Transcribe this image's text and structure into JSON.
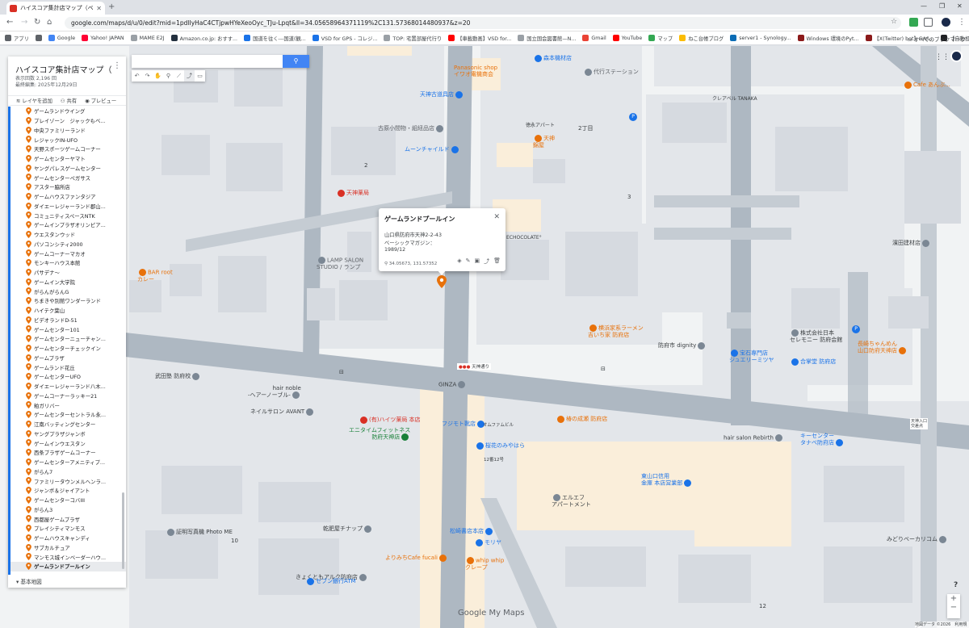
{
  "browser": {
    "tab_title": "ハイスコア集計店マップ（ベーシック...",
    "url": "google.com/maps/d/u/0/edit?mid=1pdlIyHaC4CTjpwHYeXeoOyc_TJu-Lpqt&ll=34.05658964371119%2C131.57368014480937&z=20",
    "bookmarks": [
      "アプリ",
      "Google",
      "Yahoo! JAPAN",
      "MAME E2J",
      "Amazon.co.jp: おすす...",
      "国道を往く---国道(観...",
      "VSD for GPS - コレジ...",
      "TOP: 宅置部屋代行り",
      "【車載動画】VSD for...",
      "国立国会図書館—N...",
      "Gmail",
      "YouTube",
      "マップ",
      "ねこ台帳ブログ",
      "server1 - Synology...",
      "Windows 環境のPyt...",
      "【X(Twitter) bot】GAS...",
      "【自動投稿】GASスプ..."
    ],
    "all_bookmarks": "すべてのブックマーク"
  },
  "panel": {
    "title": "ハイスコア集計店マップ（ベーシ...",
    "views": "表示回数 2,196 回",
    "edited": "最終編集: 2025年12月29日",
    "add_layer": "レイヤを追加",
    "share": "共有",
    "preview": "プレビュー",
    "items": [
      "ゲームランドウイング",
      "プレイゾーン　ジャックもベ...",
      "中央ファミリーランド",
      "レジャックIN-UFO",
      "天野スポーツゲームコーナー",
      "ゲームセンターヤマト",
      "ヤングパレスゲームセンター",
      "ゲームセンターペガサス",
      "アスター脇所店",
      "ゲームハウスファンタジア",
      "ダイエーレジャーランド郡山...",
      "コミュニティスペースNTK",
      "ゲームインプラザオリンピア...",
      "ウエスタンウッド",
      "パソコンシティ2000",
      "ゲームコーナーマカオ",
      "モンキーハウス本館",
      "パサデナ～",
      "ゲームイン大学院",
      "がらんがらんG",
      "ちまきや別館ワンダーランド",
      "ハイテク葉山",
      "ビデオランドD-51",
      "ゲームセンター101",
      "ゲームセンターニューチャン...",
      "ゲームセンターチェックイン",
      "ゲームプラザ",
      "ゲームランド花丘",
      "ゲームセンターUFO",
      "ダイエーレジャーランド八木...",
      "ゲームコーナーラッキー21",
      "粕ガリバー",
      "ゲームセンターセントラル永...",
      "江南バッティングセンター",
      "ヤングプラザジャンボ",
      "ゲームインウエスタン",
      "西条プラザゲームコーナー",
      "ゲームセンターアメニティプ...",
      "がらん7",
      "ファミリータウンメルヘンラ...",
      "ジャンボ＆ジャイアント",
      "ゲームセンターコバIII",
      "がらん3",
      "西都屋ゲームプラザ",
      "プレイシティマンモス",
      "ゲームハウスキャンディ",
      "サブカルチュア",
      "マンモス城インベーダーハウ...",
      "ゲームランドプールイン"
    ],
    "base_map": "基本地図"
  },
  "search": {
    "placeholder": ""
  },
  "popup": {
    "title": "ゲームランドプールイン",
    "address": "山口県防府市天神2-2-43",
    "line2": "ベーシックマガジン：",
    "line3": "1989/12",
    "coords": "34.05673, 131.57352"
  },
  "map_labels": {
    "panasonic": "Panasonic shop\nイワオ電機商会",
    "morimoto": "森本機材店",
    "daiko": "代行ステーション",
    "tenjin_koppu": "天神古道具店",
    "cafe_anbu": "Cafe あんぶ...",
    "kure": "クレアベル TANAKA",
    "kohara": "古原小間物・組紐品店",
    "toku_apart": "徳永アパート",
    "tenjin": "天神\n錦屋",
    "nichome": "2丁目",
    "moon": "ムーンチャイルド",
    "n2": "2",
    "n3": "3",
    "tenjin_lab": "天神薬局",
    "chocolate": "ECHOCOLATE°",
    "hamada": "濱田建材店",
    "lamp": "LAMP SALON\nSTUDIO / ランプ",
    "bar_root": "BAR root\nカレー",
    "ramen": "横浜家系ラーメン\n吉いち家 防府店",
    "dignity": "防府市 dignity",
    "seremony": "株式会社日本\nセレモニー 防府会館",
    "nagasaki": "長崎ちゃんめん\n山口防府天神店",
    "hoseki": "宝石専門店\nジュエリーミツヤ",
    "gokaku": "合掌堂 防府店",
    "takeda": "武田塾 防府校",
    "tenjin_st": "天神通り",
    "hair_noble": "hair noble\n-ヘアーノーブル-",
    "ginza": "GINZA",
    "avant": "ネイルサロン AVANT",
    "haitsu": "(有)ハイツ薬局 本店",
    "fujimoto": "フジモト靴店",
    "tsubaki": "椿の成瀬 防府店",
    "n_famu": "オムファムビル",
    "anytime": "エニタイムフィットネス\n防府天神店",
    "hanamiya": "桜花のみやはら",
    "n12": "12番12号",
    "rebirth": "hair salon Rebirth",
    "kisenter": "キーセンター\nタナベ防府店",
    "yamaguchi_bank": "東山口信用\n金庫 本店営業部",
    "elfa": "エルエフ\nアパートメント",
    "shomei": "証明写真機 Photo ME",
    "n10": "10",
    "kanshiya": "乾肥屋チナップ",
    "matsuzaki": "松崎書店本店",
    "moriya": "モリヤ",
    "whip": "whip whip\nクレープ",
    "midori": "みどりベーカリコム",
    "kyokutomo": "きょくともアルク防府店",
    "yorimichi": "よりみちCafe fucali",
    "seven": "セブン銀行ATM",
    "n12b": "12",
    "tenjin_kita": "天神入口\n交差点"
  },
  "footer": {
    "logo": "Google My Maps",
    "attribution": "地図データ ©2026　利用規約"
  },
  "colors": {
    "accent": "#1a73e8",
    "pin": "#e8710a",
    "road": "#aeb8c2",
    "block": "#f1f3f4"
  }
}
